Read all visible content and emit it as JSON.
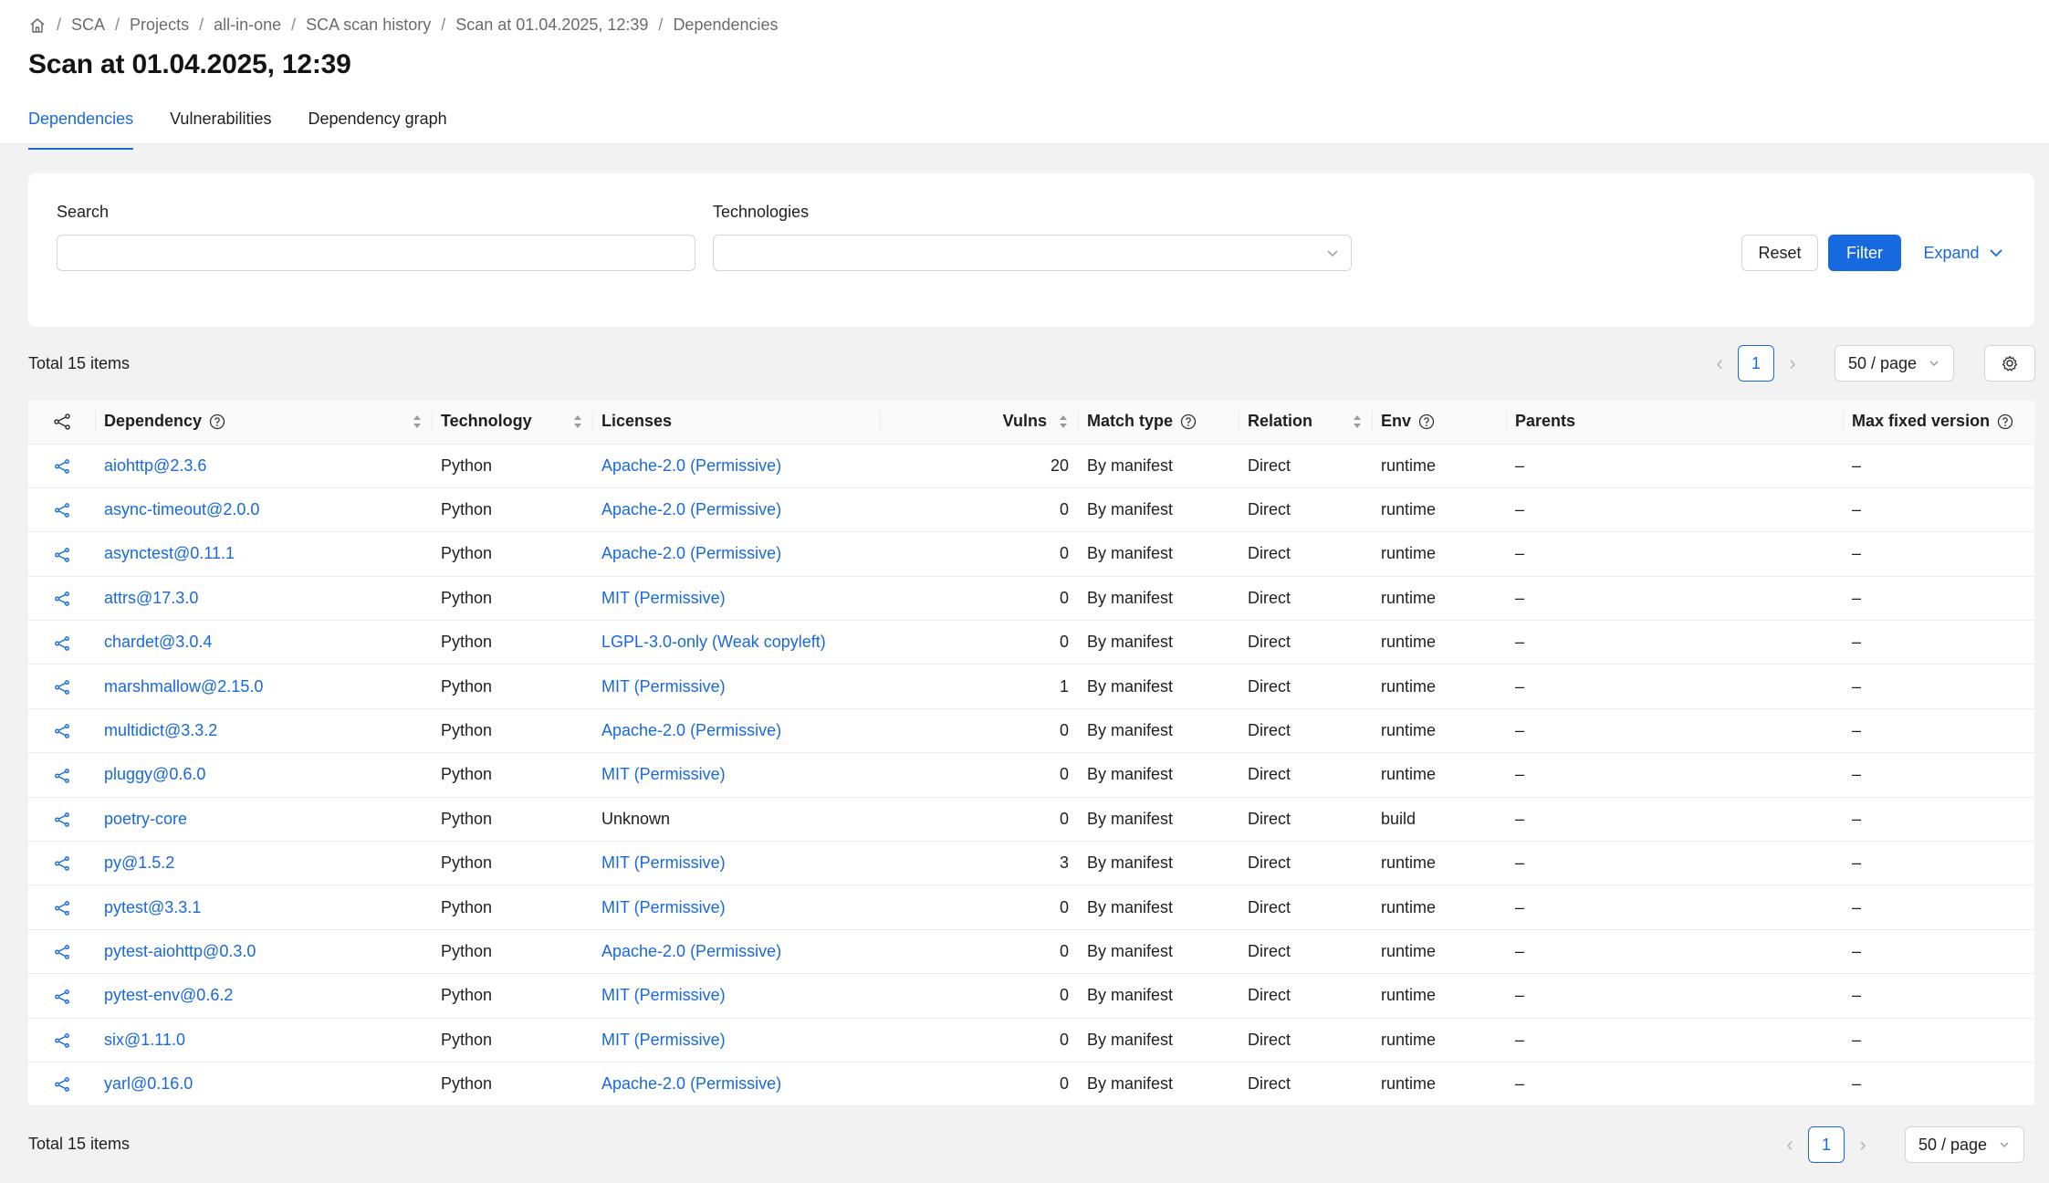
{
  "breadcrumb": {
    "items": [
      "SCA",
      "Projects",
      "all-in-one",
      "SCA scan history",
      "Scan at 01.04.2025, 12:39",
      "Dependencies"
    ],
    "separator": "/"
  },
  "page": {
    "title": "Scan at 01.04.2025, 12:39"
  },
  "tabs": [
    {
      "label": "Dependencies",
      "active": true
    },
    {
      "label": "Vulnerabilities",
      "active": false
    },
    {
      "label": "Dependency graph",
      "active": false
    }
  ],
  "filters": {
    "search_label": "Search",
    "search_value": "",
    "technologies_label": "Technologies",
    "technologies_value": "",
    "reset_label": "Reset",
    "filter_label": "Filter",
    "expand_label": "Expand"
  },
  "pagination": {
    "total_text": "Total 15 items",
    "current_page": "1",
    "page_size": "50 / page"
  },
  "table": {
    "columns": {
      "dependency": "Dependency",
      "technology": "Technology",
      "licenses": "Licenses",
      "vulns": "Vulns",
      "match_type": "Match type",
      "relation": "Relation",
      "env": "Env",
      "parents": "Parents",
      "max_fixed_version": "Max fixed version"
    },
    "rows": [
      {
        "dependency": "aiohttp@2.3.6",
        "technology": "Python",
        "license": "Apache-2.0 (Permissive)",
        "license_link": true,
        "vulns": "20",
        "match_type": "By manifest",
        "relation": "Direct",
        "env": "runtime",
        "parents": "–",
        "max_fixed_version": "–"
      },
      {
        "dependency": "async-timeout@2.0.0",
        "technology": "Python",
        "license": "Apache-2.0 (Permissive)",
        "license_link": true,
        "vulns": "0",
        "match_type": "By manifest",
        "relation": "Direct",
        "env": "runtime",
        "parents": "–",
        "max_fixed_version": "–"
      },
      {
        "dependency": "asynctest@0.11.1",
        "technology": "Python",
        "license": "Apache-2.0 (Permissive)",
        "license_link": true,
        "vulns": "0",
        "match_type": "By manifest",
        "relation": "Direct",
        "env": "runtime",
        "parents": "–",
        "max_fixed_version": "–"
      },
      {
        "dependency": "attrs@17.3.0",
        "technology": "Python",
        "license": "MIT (Permissive)",
        "license_link": true,
        "vulns": "0",
        "match_type": "By manifest",
        "relation": "Direct",
        "env": "runtime",
        "parents": "–",
        "max_fixed_version": "–"
      },
      {
        "dependency": "chardet@3.0.4",
        "technology": "Python",
        "license": "LGPL-3.0-only (Weak copyleft)",
        "license_link": true,
        "vulns": "0",
        "match_type": "By manifest",
        "relation": "Direct",
        "env": "runtime",
        "parents": "–",
        "max_fixed_version": "–"
      },
      {
        "dependency": "marshmallow@2.15.0",
        "technology": "Python",
        "license": "MIT (Permissive)",
        "license_link": true,
        "vulns": "1",
        "match_type": "By manifest",
        "relation": "Direct",
        "env": "runtime",
        "parents": "–",
        "max_fixed_version": "–"
      },
      {
        "dependency": "multidict@3.3.2",
        "technology": "Python",
        "license": "Apache-2.0 (Permissive)",
        "license_link": true,
        "vulns": "0",
        "match_type": "By manifest",
        "relation": "Direct",
        "env": "runtime",
        "parents": "–",
        "max_fixed_version": "–"
      },
      {
        "dependency": "pluggy@0.6.0",
        "technology": "Python",
        "license": "MIT (Permissive)",
        "license_link": true,
        "vulns": "0",
        "match_type": "By manifest",
        "relation": "Direct",
        "env": "runtime",
        "parents": "–",
        "max_fixed_version": "–"
      },
      {
        "dependency": "poetry-core",
        "technology": "Python",
        "license": "Unknown",
        "license_link": false,
        "vulns": "0",
        "match_type": "By manifest",
        "relation": "Direct",
        "env": "build",
        "parents": "–",
        "max_fixed_version": "–"
      },
      {
        "dependency": "py@1.5.2",
        "technology": "Python",
        "license": "MIT (Permissive)",
        "license_link": true,
        "vulns": "3",
        "match_type": "By manifest",
        "relation": "Direct",
        "env": "runtime",
        "parents": "–",
        "max_fixed_version": "–"
      },
      {
        "dependency": "pytest@3.3.1",
        "technology": "Python",
        "license": "MIT (Permissive)",
        "license_link": true,
        "vulns": "0",
        "match_type": "By manifest",
        "relation": "Direct",
        "env": "runtime",
        "parents": "–",
        "max_fixed_version": "–"
      },
      {
        "dependency": "pytest-aiohttp@0.3.0",
        "technology": "Python",
        "license": "Apache-2.0 (Permissive)",
        "license_link": true,
        "vulns": "0",
        "match_type": "By manifest",
        "relation": "Direct",
        "env": "runtime",
        "parents": "–",
        "max_fixed_version": "–"
      },
      {
        "dependency": "pytest-env@0.6.2",
        "technology": "Python",
        "license": "MIT (Permissive)",
        "license_link": true,
        "vulns": "0",
        "match_type": "By manifest",
        "relation": "Direct",
        "env": "runtime",
        "parents": "–",
        "max_fixed_version": "–"
      },
      {
        "dependency": "six@1.11.0",
        "technology": "Python",
        "license": "MIT (Permissive)",
        "license_link": true,
        "vulns": "0",
        "match_type": "By manifest",
        "relation": "Direct",
        "env": "runtime",
        "parents": "–",
        "max_fixed_version": "–"
      },
      {
        "dependency": "yarl@0.16.0",
        "technology": "Python",
        "license": "Apache-2.0 (Permissive)",
        "license_link": true,
        "vulns": "0",
        "match_type": "By manifest",
        "relation": "Direct",
        "env": "runtime",
        "parents": "–",
        "max_fixed_version": "–"
      }
    ]
  },
  "icons": {
    "home": "home-icon",
    "graph": "share-graph-icon",
    "help": "question-circle-icon",
    "sort": "sort-icon",
    "settings": "gear-icon",
    "chevron": "chevron-down-icon"
  },
  "colors": {
    "accent": "#1769e0",
    "background": "#f2f2f2"
  }
}
